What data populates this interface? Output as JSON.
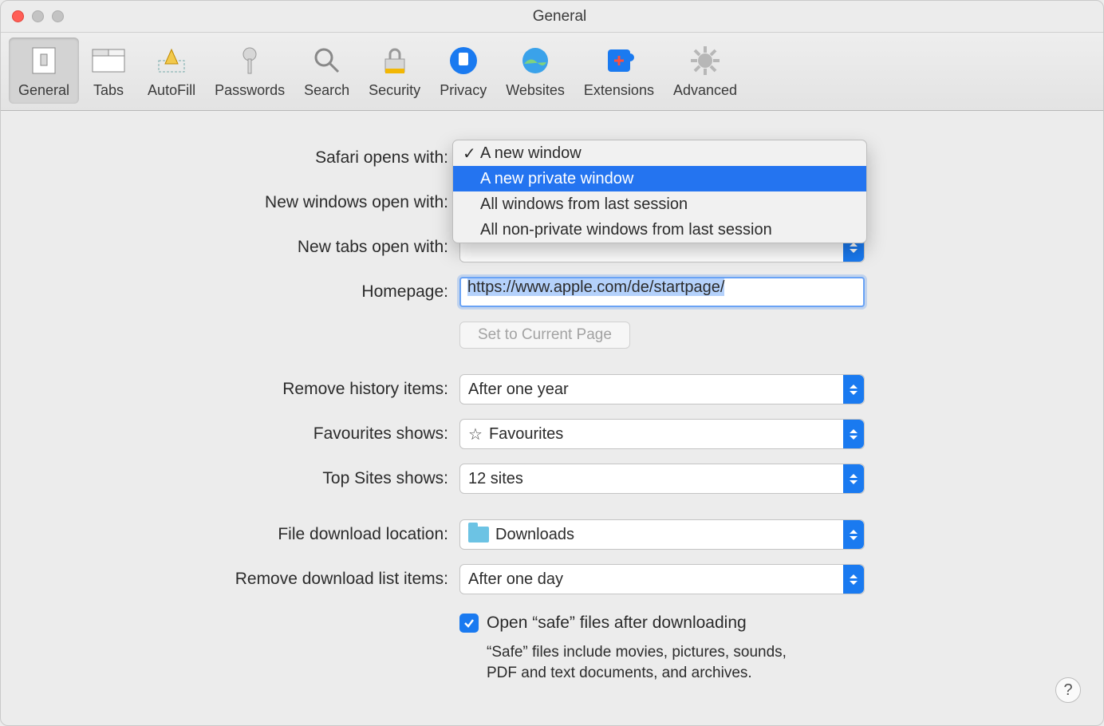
{
  "window": {
    "title": "General"
  },
  "toolbar": [
    {
      "label": "General"
    },
    {
      "label": "Tabs"
    },
    {
      "label": "AutoFill"
    },
    {
      "label": "Passwords"
    },
    {
      "label": "Search"
    },
    {
      "label": "Security"
    },
    {
      "label": "Privacy"
    },
    {
      "label": "Websites"
    },
    {
      "label": "Extensions"
    },
    {
      "label": "Advanced"
    }
  ],
  "labels": {
    "safari_opens_with": "Safari opens with:",
    "new_windows": "New windows open with:",
    "new_tabs": "New tabs open with:",
    "homepage": "Homepage:",
    "set_current": "Set to Current Page",
    "remove_history": "Remove history items:",
    "favourites_shows": "Favourites shows:",
    "top_sites_shows": "Top Sites shows:",
    "download_location": "File download location:",
    "remove_downloads": "Remove download list items:",
    "open_safe": "Open “safe” files after downloading",
    "safe_desc": "“Safe” files include movies, pictures, sounds, PDF and text documents, and archives."
  },
  "values": {
    "homepage": "https://www.apple.com/de/startpage/",
    "remove_history": "After one year",
    "favourites": "Favourites",
    "top_sites": "12 sites",
    "download_location": "Downloads",
    "remove_downloads": "After one day",
    "open_safe_checked": true
  },
  "dropdown": {
    "options": [
      {
        "label": "A new window",
        "checked": true,
        "highlight": false
      },
      {
        "label": "A new private window",
        "checked": false,
        "highlight": true
      },
      {
        "label": "All windows from last session",
        "checked": false,
        "highlight": false
      },
      {
        "label": "All non-private windows from last session",
        "checked": false,
        "highlight": false
      }
    ]
  },
  "help": "?"
}
